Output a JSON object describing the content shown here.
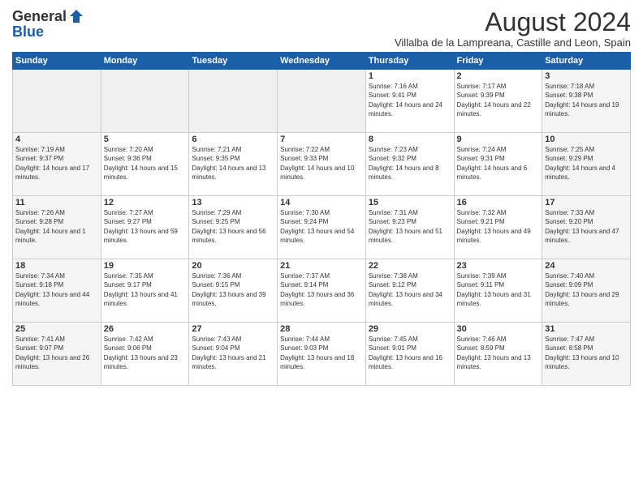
{
  "header": {
    "logo_general": "General",
    "logo_blue": "Blue",
    "month_year": "August 2024",
    "location": "Villalba de la Lampreana, Castille and Leon, Spain"
  },
  "days_of_week": [
    "Sunday",
    "Monday",
    "Tuesday",
    "Wednesday",
    "Thursday",
    "Friday",
    "Saturday"
  ],
  "weeks": [
    [
      {
        "day": "",
        "empty": true
      },
      {
        "day": "",
        "empty": true
      },
      {
        "day": "",
        "empty": true
      },
      {
        "day": "",
        "empty": true
      },
      {
        "day": "1",
        "sunrise": "7:16 AM",
        "sunset": "9:41 PM",
        "daylight": "14 hours and 24 minutes."
      },
      {
        "day": "2",
        "sunrise": "7:17 AM",
        "sunset": "9:39 PM",
        "daylight": "14 hours and 22 minutes."
      },
      {
        "day": "3",
        "sunrise": "7:18 AM",
        "sunset": "9:38 PM",
        "daylight": "14 hours and 19 minutes."
      }
    ],
    [
      {
        "day": "4",
        "sunrise": "7:19 AM",
        "sunset": "9:37 PM",
        "daylight": "14 hours and 17 minutes."
      },
      {
        "day": "5",
        "sunrise": "7:20 AM",
        "sunset": "9:36 PM",
        "daylight": "14 hours and 15 minutes."
      },
      {
        "day": "6",
        "sunrise": "7:21 AM",
        "sunset": "9:35 PM",
        "daylight": "14 hours and 13 minutes."
      },
      {
        "day": "7",
        "sunrise": "7:22 AM",
        "sunset": "9:33 PM",
        "daylight": "14 hours and 10 minutes."
      },
      {
        "day": "8",
        "sunrise": "7:23 AM",
        "sunset": "9:32 PM",
        "daylight": "14 hours and 8 minutes."
      },
      {
        "day": "9",
        "sunrise": "7:24 AM",
        "sunset": "9:31 PM",
        "daylight": "14 hours and 6 minutes."
      },
      {
        "day": "10",
        "sunrise": "7:25 AM",
        "sunset": "9:29 PM",
        "daylight": "14 hours and 4 minutes."
      }
    ],
    [
      {
        "day": "11",
        "sunrise": "7:26 AM",
        "sunset": "9:28 PM",
        "daylight": "14 hours and 1 minute."
      },
      {
        "day": "12",
        "sunrise": "7:27 AM",
        "sunset": "9:27 PM",
        "daylight": "13 hours and 59 minutes."
      },
      {
        "day": "13",
        "sunrise": "7:29 AM",
        "sunset": "9:25 PM",
        "daylight": "13 hours and 56 minutes."
      },
      {
        "day": "14",
        "sunrise": "7:30 AM",
        "sunset": "9:24 PM",
        "daylight": "13 hours and 54 minutes."
      },
      {
        "day": "15",
        "sunrise": "7:31 AM",
        "sunset": "9:23 PM",
        "daylight": "13 hours and 51 minutes."
      },
      {
        "day": "16",
        "sunrise": "7:32 AM",
        "sunset": "9:21 PM",
        "daylight": "13 hours and 49 minutes."
      },
      {
        "day": "17",
        "sunrise": "7:33 AM",
        "sunset": "9:20 PM",
        "daylight": "13 hours and 47 minutes."
      }
    ],
    [
      {
        "day": "18",
        "sunrise": "7:34 AM",
        "sunset": "9:18 PM",
        "daylight": "13 hours and 44 minutes."
      },
      {
        "day": "19",
        "sunrise": "7:35 AM",
        "sunset": "9:17 PM",
        "daylight": "13 hours and 41 minutes."
      },
      {
        "day": "20",
        "sunrise": "7:36 AM",
        "sunset": "9:15 PM",
        "daylight": "13 hours and 39 minutes."
      },
      {
        "day": "21",
        "sunrise": "7:37 AM",
        "sunset": "9:14 PM",
        "daylight": "13 hours and 36 minutes."
      },
      {
        "day": "22",
        "sunrise": "7:38 AM",
        "sunset": "9:12 PM",
        "daylight": "13 hours and 34 minutes."
      },
      {
        "day": "23",
        "sunrise": "7:39 AM",
        "sunset": "9:11 PM",
        "daylight": "13 hours and 31 minutes."
      },
      {
        "day": "24",
        "sunrise": "7:40 AM",
        "sunset": "9:09 PM",
        "daylight": "13 hours and 29 minutes."
      }
    ],
    [
      {
        "day": "25",
        "sunrise": "7:41 AM",
        "sunset": "9:07 PM",
        "daylight": "13 hours and 26 minutes."
      },
      {
        "day": "26",
        "sunrise": "7:42 AM",
        "sunset": "9:06 PM",
        "daylight": "13 hours and 23 minutes."
      },
      {
        "day": "27",
        "sunrise": "7:43 AM",
        "sunset": "9:04 PM",
        "daylight": "13 hours and 21 minutes."
      },
      {
        "day": "28",
        "sunrise": "7:44 AM",
        "sunset": "9:03 PM",
        "daylight": "13 hours and 18 minutes."
      },
      {
        "day": "29",
        "sunrise": "7:45 AM",
        "sunset": "9:01 PM",
        "daylight": "13 hours and 16 minutes."
      },
      {
        "day": "30",
        "sunrise": "7:46 AM",
        "sunset": "8:59 PM",
        "daylight": "13 hours and 13 minutes."
      },
      {
        "day": "31",
        "sunrise": "7:47 AM",
        "sunset": "8:58 PM",
        "daylight": "13 hours and 10 minutes."
      }
    ]
  ]
}
